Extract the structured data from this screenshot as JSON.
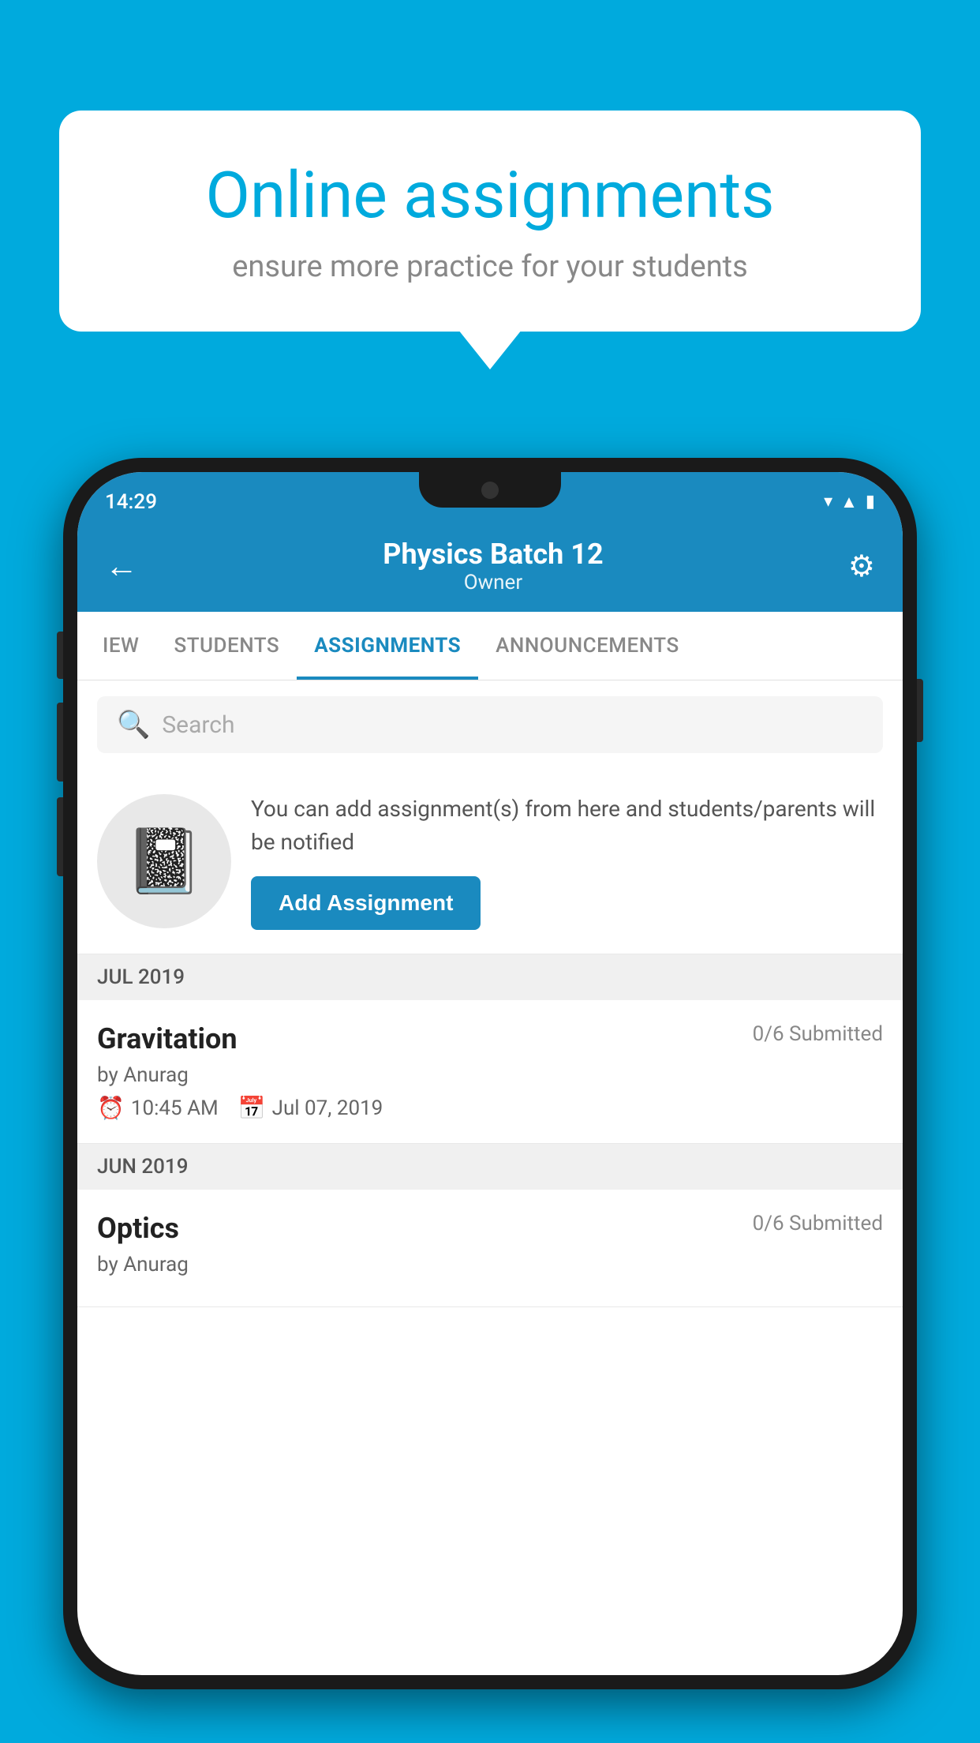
{
  "background": {
    "color": "#00AADD"
  },
  "speech_bubble": {
    "title": "Online assignments",
    "subtitle": "ensure more practice for your students"
  },
  "phone": {
    "status_bar": {
      "time": "14:29",
      "icons": [
        "wifi",
        "signal",
        "battery"
      ]
    },
    "header": {
      "title": "Physics Batch 12",
      "subtitle": "Owner",
      "back_label": "←",
      "settings_label": "⚙"
    },
    "tabs": [
      {
        "label": "IEW",
        "active": false
      },
      {
        "label": "STUDENTS",
        "active": false
      },
      {
        "label": "ASSIGNMENTS",
        "active": true
      },
      {
        "label": "ANNOUNCEMENTS",
        "active": false
      }
    ],
    "search": {
      "placeholder": "Search"
    },
    "promo": {
      "text": "You can add assignment(s) from here and students/parents will be notified",
      "button_label": "Add Assignment"
    },
    "months": [
      {
        "label": "JUL 2019",
        "assignments": [
          {
            "title": "Gravitation",
            "submitted": "0/6 Submitted",
            "by": "by Anurag",
            "time": "10:45 AM",
            "date": "Jul 07, 2019"
          }
        ]
      },
      {
        "label": "JUN 2019",
        "assignments": [
          {
            "title": "Optics",
            "submitted": "0/6 Submitted",
            "by": "by Anurag",
            "time": "",
            "date": ""
          }
        ]
      }
    ]
  }
}
